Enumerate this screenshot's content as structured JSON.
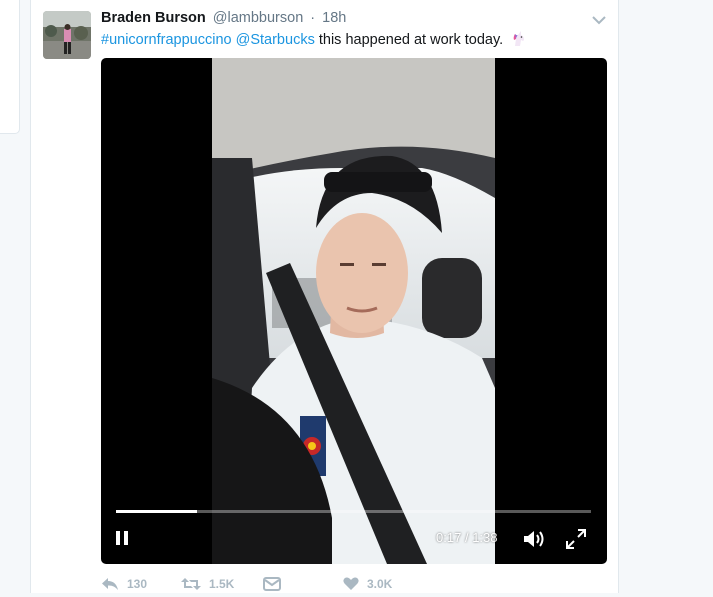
{
  "tweet": {
    "fullname": "Braden Burson",
    "username": "@lambburson",
    "separator": "·",
    "time": "18h",
    "hashtag": "#unicornfrappuccino",
    "mention": "@Starbucks",
    "text": "this happened at work today.",
    "emoji": "unicorn-emoji"
  },
  "video": {
    "elapsed": "0:17",
    "duration": "1:38",
    "time_separator": "/",
    "progress": 0.17
  },
  "actions": {
    "reply_count": "130",
    "retweet_count": "1.5K",
    "like_count": "3.0K"
  },
  "colors": {
    "link": "#1b95e0",
    "name": "#14171a",
    "muted": "#657786",
    "action": "#aab8c2",
    "border": "#e1e8ed"
  }
}
